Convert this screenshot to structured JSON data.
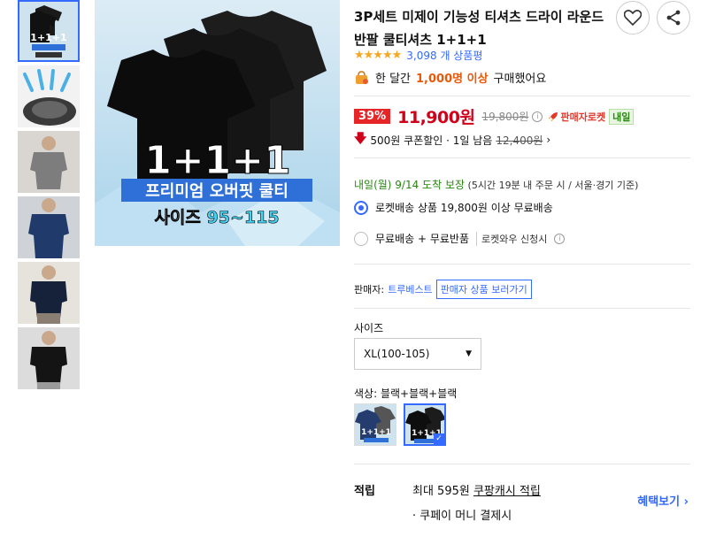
{
  "product": {
    "title": "3P세트 미제이 기능성 티셔츠 드라이 라운드 반팔 쿨티셔츠 1+1+1",
    "rating_stars": "★★★★★",
    "rating_count": "3,098 개 상품평",
    "buyers_prefix": "한 달간",
    "buyers_count": "1,000명 이상",
    "buyers_suffix": "구매했어요"
  },
  "main_image": {
    "overlay_big": "1+1+1",
    "overlay_line1": "프리미엄 오버핏 쿨티",
    "overlay_line2_a": "사이즈 ",
    "overlay_line2_b": "95~115"
  },
  "price": {
    "discount": "39%",
    "sale_price": "11,900원",
    "original_price": "19,800원",
    "info_icon": "i",
    "rocket_label": "판매자로켓",
    "tomorrow_badge": "내일",
    "coupon_text": "500원 쿠폰할인 · 1일 남음",
    "coupon_original": "12,400원",
    "coupon_chevron": "›"
  },
  "delivery": {
    "arrival": "내일(월) 9/14 도착 보장",
    "arrival_note": "(5시간 19분 내 주문 시 / 서울·경기 기준)",
    "option1": "로켓배송 상품 19,800원 이상 무료배송",
    "option2": "무료배송 + 무료반품",
    "option2_sub": "로켓와우 신청시",
    "option2_info": "i"
  },
  "seller": {
    "label": "판매자:",
    "name": "트루베스트",
    "button": "판매자 상품 보러가기"
  },
  "options": {
    "size_label": "사이즈",
    "size_value": "XL(100-105)",
    "color_label": "색상: 블랙+블랙+블랙",
    "swatch_text": "1+1+1",
    "check": "✓"
  },
  "reward": {
    "label": "적립",
    "line1_prefix": "최대 595원",
    "line1_link": "쿠팡캐시 적립",
    "line2": "· 쿠페이 머니 결제시",
    "benefit": "혜택보기 ›"
  },
  "colors": {
    "accent": "#346aff",
    "price_red": "#d0021b",
    "discount_red": "#e52528",
    "star": "#f5a623",
    "green": "#27860f",
    "orange": "#e8590c"
  }
}
